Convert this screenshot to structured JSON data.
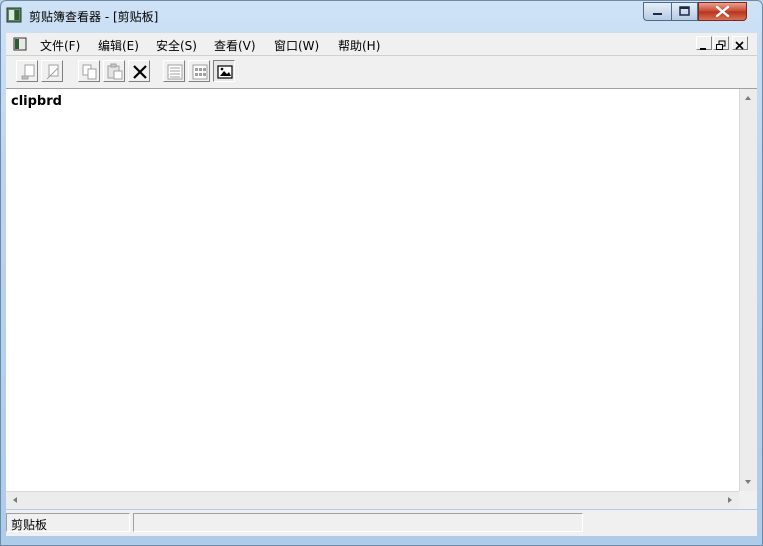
{
  "window": {
    "title": "剪贴簿查看器 - [剪贴板]"
  },
  "menu": {
    "items": [
      {
        "label": "文件(F)"
      },
      {
        "label": "编辑(E)"
      },
      {
        "label": "安全(S)"
      },
      {
        "label": "查看(V)"
      },
      {
        "label": "窗口(W)"
      },
      {
        "label": "帮助(H)"
      }
    ]
  },
  "toolbar": {
    "buttons": [
      {
        "icon": "connect-icon",
        "enabled": false
      },
      {
        "icon": "disconnect-icon",
        "enabled": false
      },
      {
        "icon": "copy-icon",
        "enabled": false
      },
      {
        "icon": "paste-icon",
        "enabled": false
      },
      {
        "icon": "delete-icon",
        "enabled": true
      },
      {
        "icon": "list-view-icon",
        "enabled": false
      },
      {
        "icon": "thumbnail-view-icon",
        "enabled": false
      },
      {
        "icon": "page-view-icon",
        "enabled": true,
        "pressed": true
      }
    ]
  },
  "content": {
    "text": "clipbrd"
  },
  "statusbar": {
    "text": "剪贴板",
    "second": ""
  }
}
